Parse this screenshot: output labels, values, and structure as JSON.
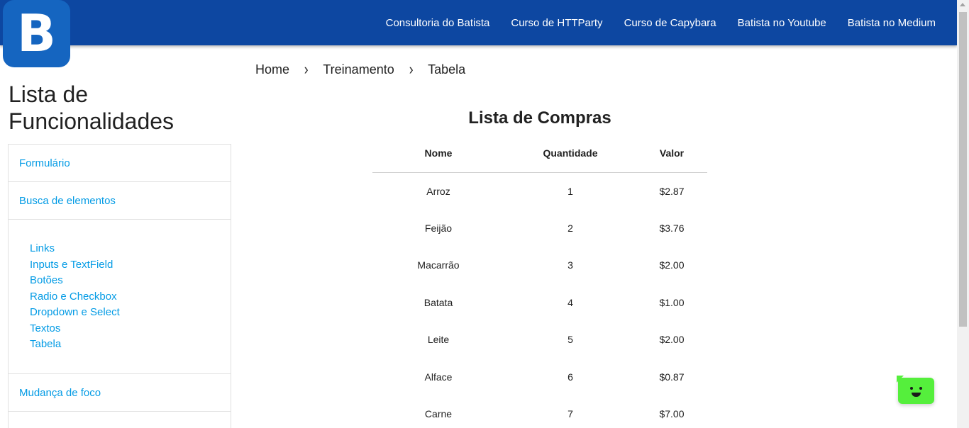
{
  "nav": {
    "logo_letter": "B",
    "links": [
      {
        "label": "Consultoria do Batista"
      },
      {
        "label": "Curso de HTTParty"
      },
      {
        "label": "Curso de Capybara"
      },
      {
        "label": "Batista no Youtube"
      },
      {
        "label": "Batista no Medium"
      }
    ]
  },
  "sidebar": {
    "title": "Lista de Funcionalidades",
    "items": [
      {
        "label": "Formulário"
      },
      {
        "label": "Busca de elementos"
      }
    ],
    "sub_items": [
      {
        "label": "Links"
      },
      {
        "label": "Inputs e TextField"
      },
      {
        "label": "Botões"
      },
      {
        "label": "Radio e Checkbox"
      },
      {
        "label": "Dropdown e Select"
      },
      {
        "label": "Textos"
      },
      {
        "label": "Tabela"
      }
    ],
    "items_after": [
      {
        "label": "Mudança de foco"
      }
    ]
  },
  "breadcrumb": {
    "items": [
      "Home",
      "Treinamento",
      "Tabela"
    ],
    "separator": "›"
  },
  "table": {
    "title": "Lista de Compras",
    "headers": [
      "Nome",
      "Quantidade",
      "Valor"
    ],
    "rows": [
      [
        "Arroz",
        "1",
        "$2.87"
      ],
      [
        "Feijão",
        "2",
        "$3.76"
      ],
      [
        "Macarrão",
        "3",
        "$2.00"
      ],
      [
        "Batata",
        "4",
        "$1.00"
      ],
      [
        "Leite",
        "5",
        "$2.00"
      ],
      [
        "Alface",
        "6",
        "$0.87"
      ],
      [
        "Carne",
        "7",
        "$7.00"
      ]
    ]
  },
  "colors": {
    "navbar": "#0d47a1",
    "logo": "#1565c0",
    "link": "#039be5",
    "chat_widget": "#55ef3c"
  },
  "icons": {
    "breadcrumb_separator": "chevron-right-icon",
    "chat": "chat-bot-icon"
  }
}
